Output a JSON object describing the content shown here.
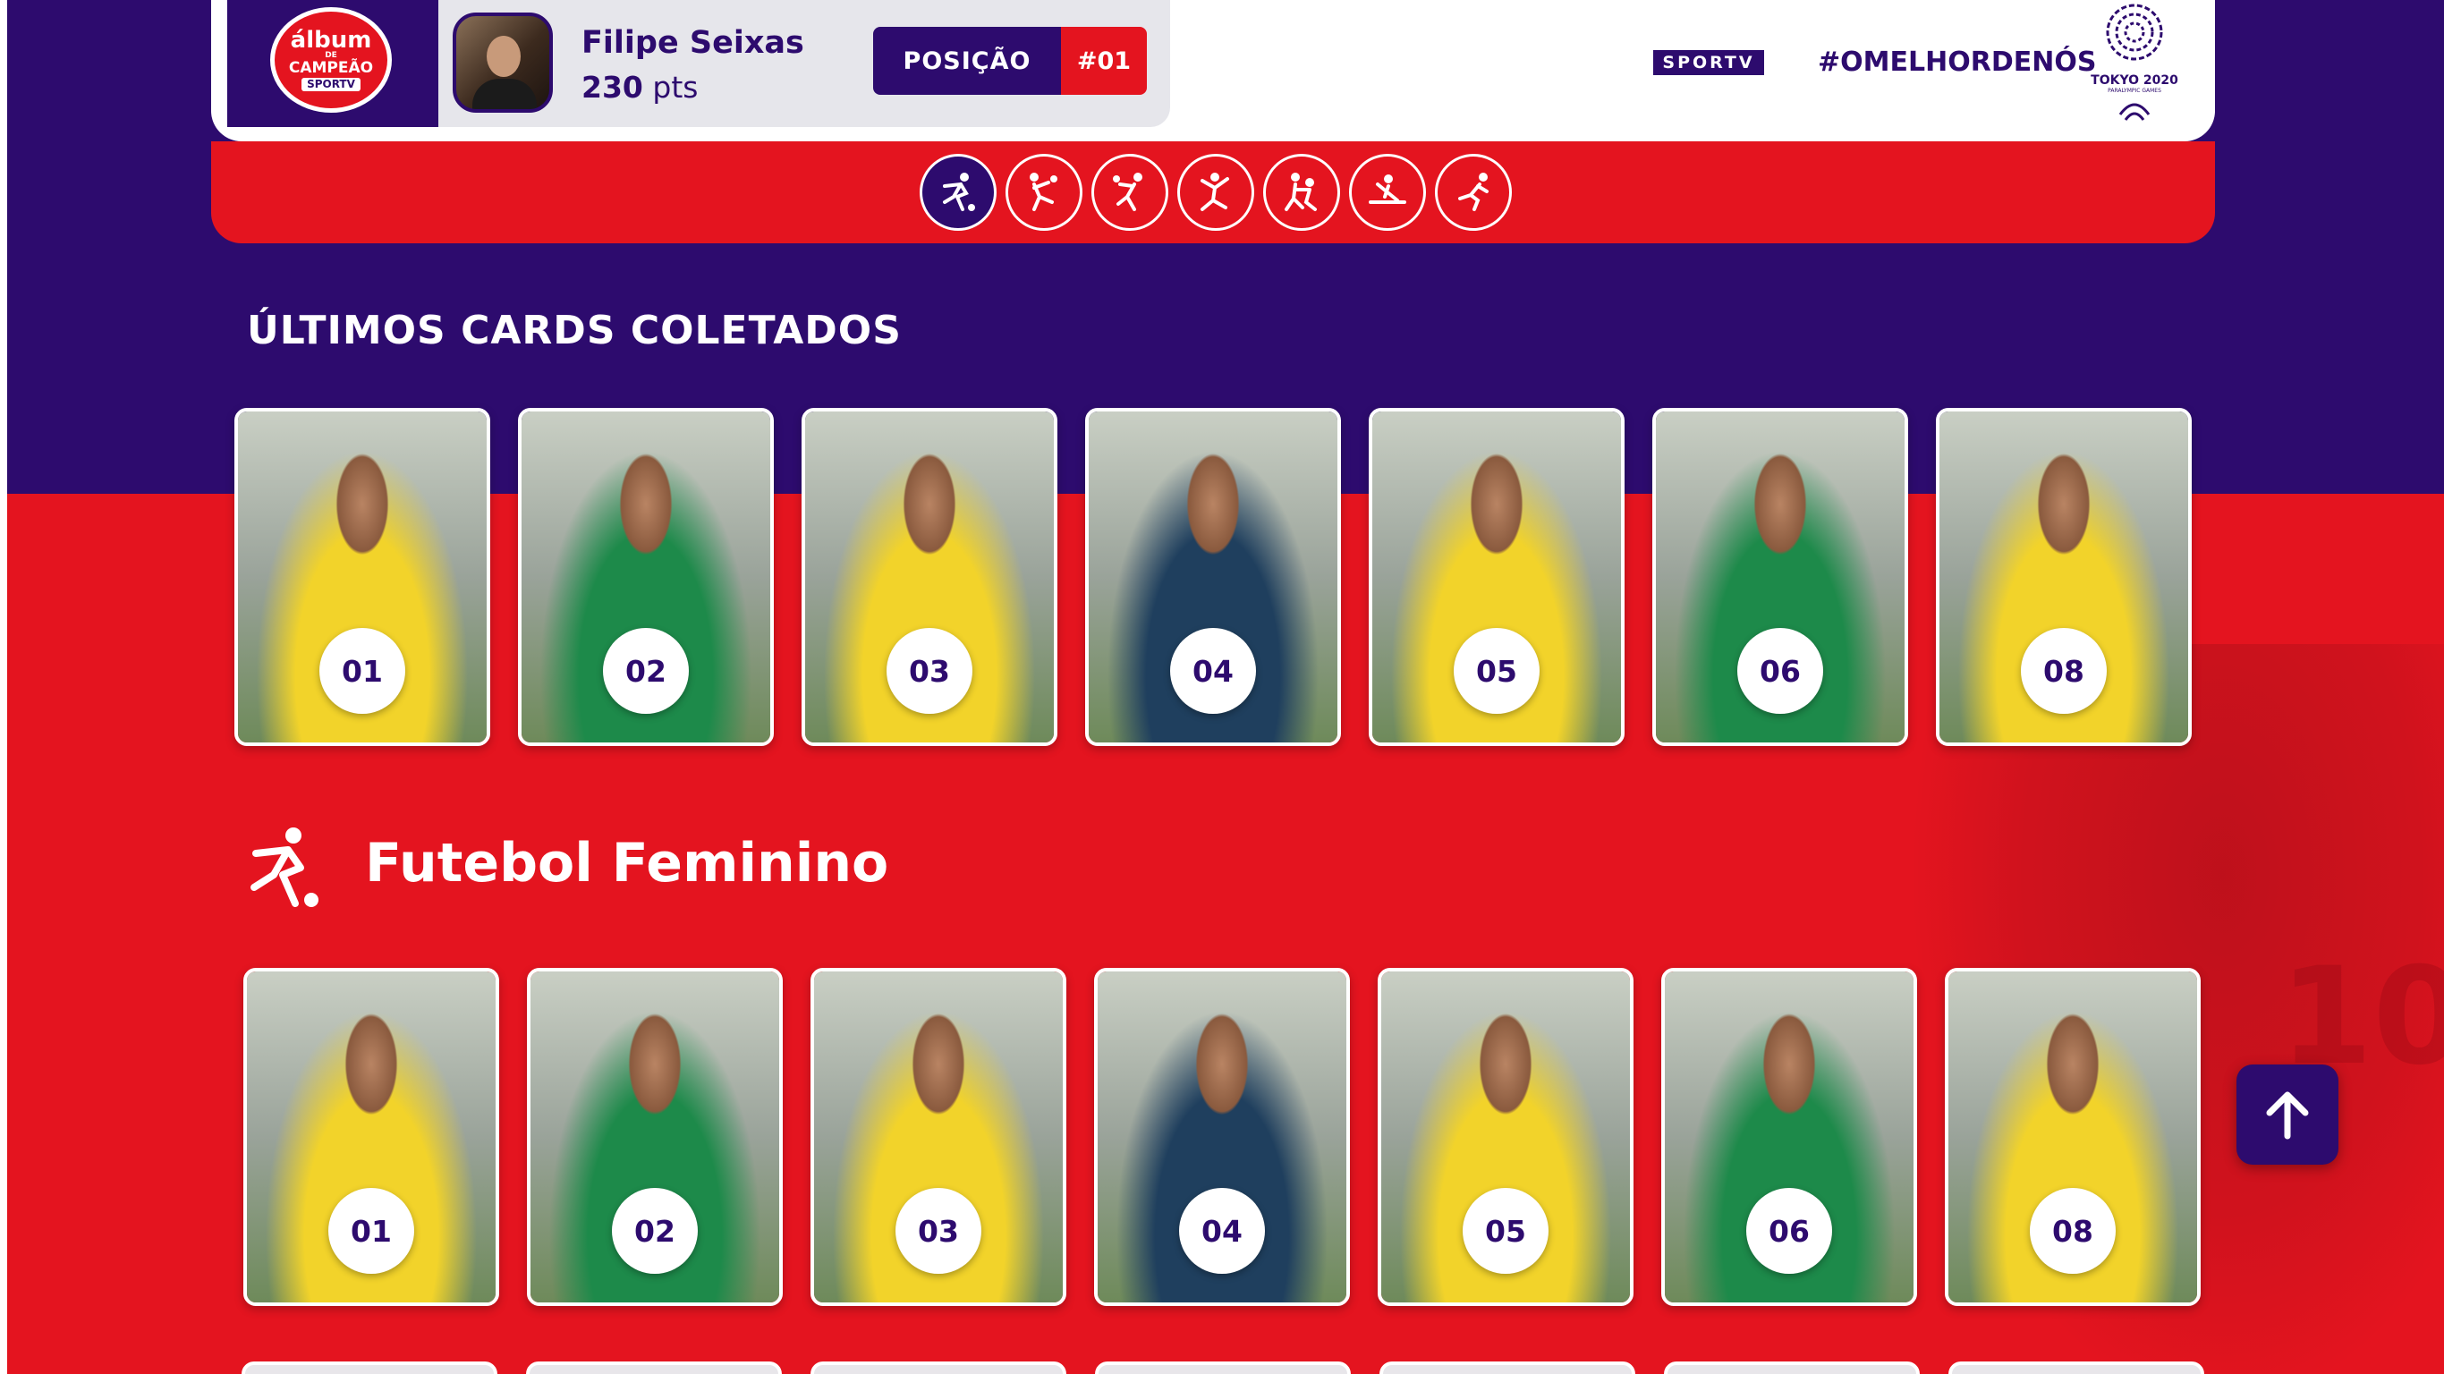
{
  "colors": {
    "purple": "#2d0b6e",
    "red": "#e4141f",
    "white": "#ffffff",
    "kit_yellow": "#f2d32a",
    "kit_green": "#1d8a4a",
    "kit_navy": "#1f3f5e"
  },
  "header": {
    "logo": {
      "line1": "álbum",
      "line2": "DE",
      "line3": "CAMPEÃO",
      "line4": "SPORTV"
    },
    "user": {
      "name": "Filipe Seixas",
      "points_value": "230",
      "points_unit": "pts"
    },
    "position_label": "POSIÇÃO",
    "position_rank": "#01",
    "sportv": "SPORTV",
    "hashtag": "#OMELHORDENÓS",
    "tokyo": "TOKYO 2020",
    "tokyo_sub": "PARALYMPIC GAMES"
  },
  "sports_nav": [
    {
      "icon": "football-icon",
      "active": true
    },
    {
      "icon": "handball-icon",
      "active": false
    },
    {
      "icon": "volleyball-icon",
      "active": false
    },
    {
      "icon": "gymnastics-icon",
      "active": false
    },
    {
      "icon": "judo-icon",
      "active": false
    },
    {
      "icon": "canoe-icon",
      "active": false
    },
    {
      "icon": "athletics-icon",
      "active": false
    }
  ],
  "recent": {
    "title": "ÚLTIMOS CARDS COLETADOS",
    "cards": [
      {
        "number": "01",
        "kit": "yellow"
      },
      {
        "number": "02",
        "kit": "green"
      },
      {
        "number": "03",
        "kit": "yellow"
      },
      {
        "number": "04",
        "kit": "navy"
      },
      {
        "number": "05",
        "kit": "yellow"
      },
      {
        "number": "06",
        "kit": "green"
      },
      {
        "number": "08",
        "kit": "yellow"
      }
    ]
  },
  "category": {
    "title": "Futebol Feminino",
    "icon": "football-player-icon",
    "cards": [
      {
        "number": "01",
        "kit": "yellow"
      },
      {
        "number": "02",
        "kit": "green"
      },
      {
        "number": "03",
        "kit": "yellow"
      },
      {
        "number": "04",
        "kit": "navy"
      },
      {
        "number": "05",
        "kit": "yellow"
      },
      {
        "number": "06",
        "kit": "green"
      },
      {
        "number": "08",
        "kit": "yellow"
      }
    ]
  },
  "scroll_top_icon": "arrow-up-icon"
}
